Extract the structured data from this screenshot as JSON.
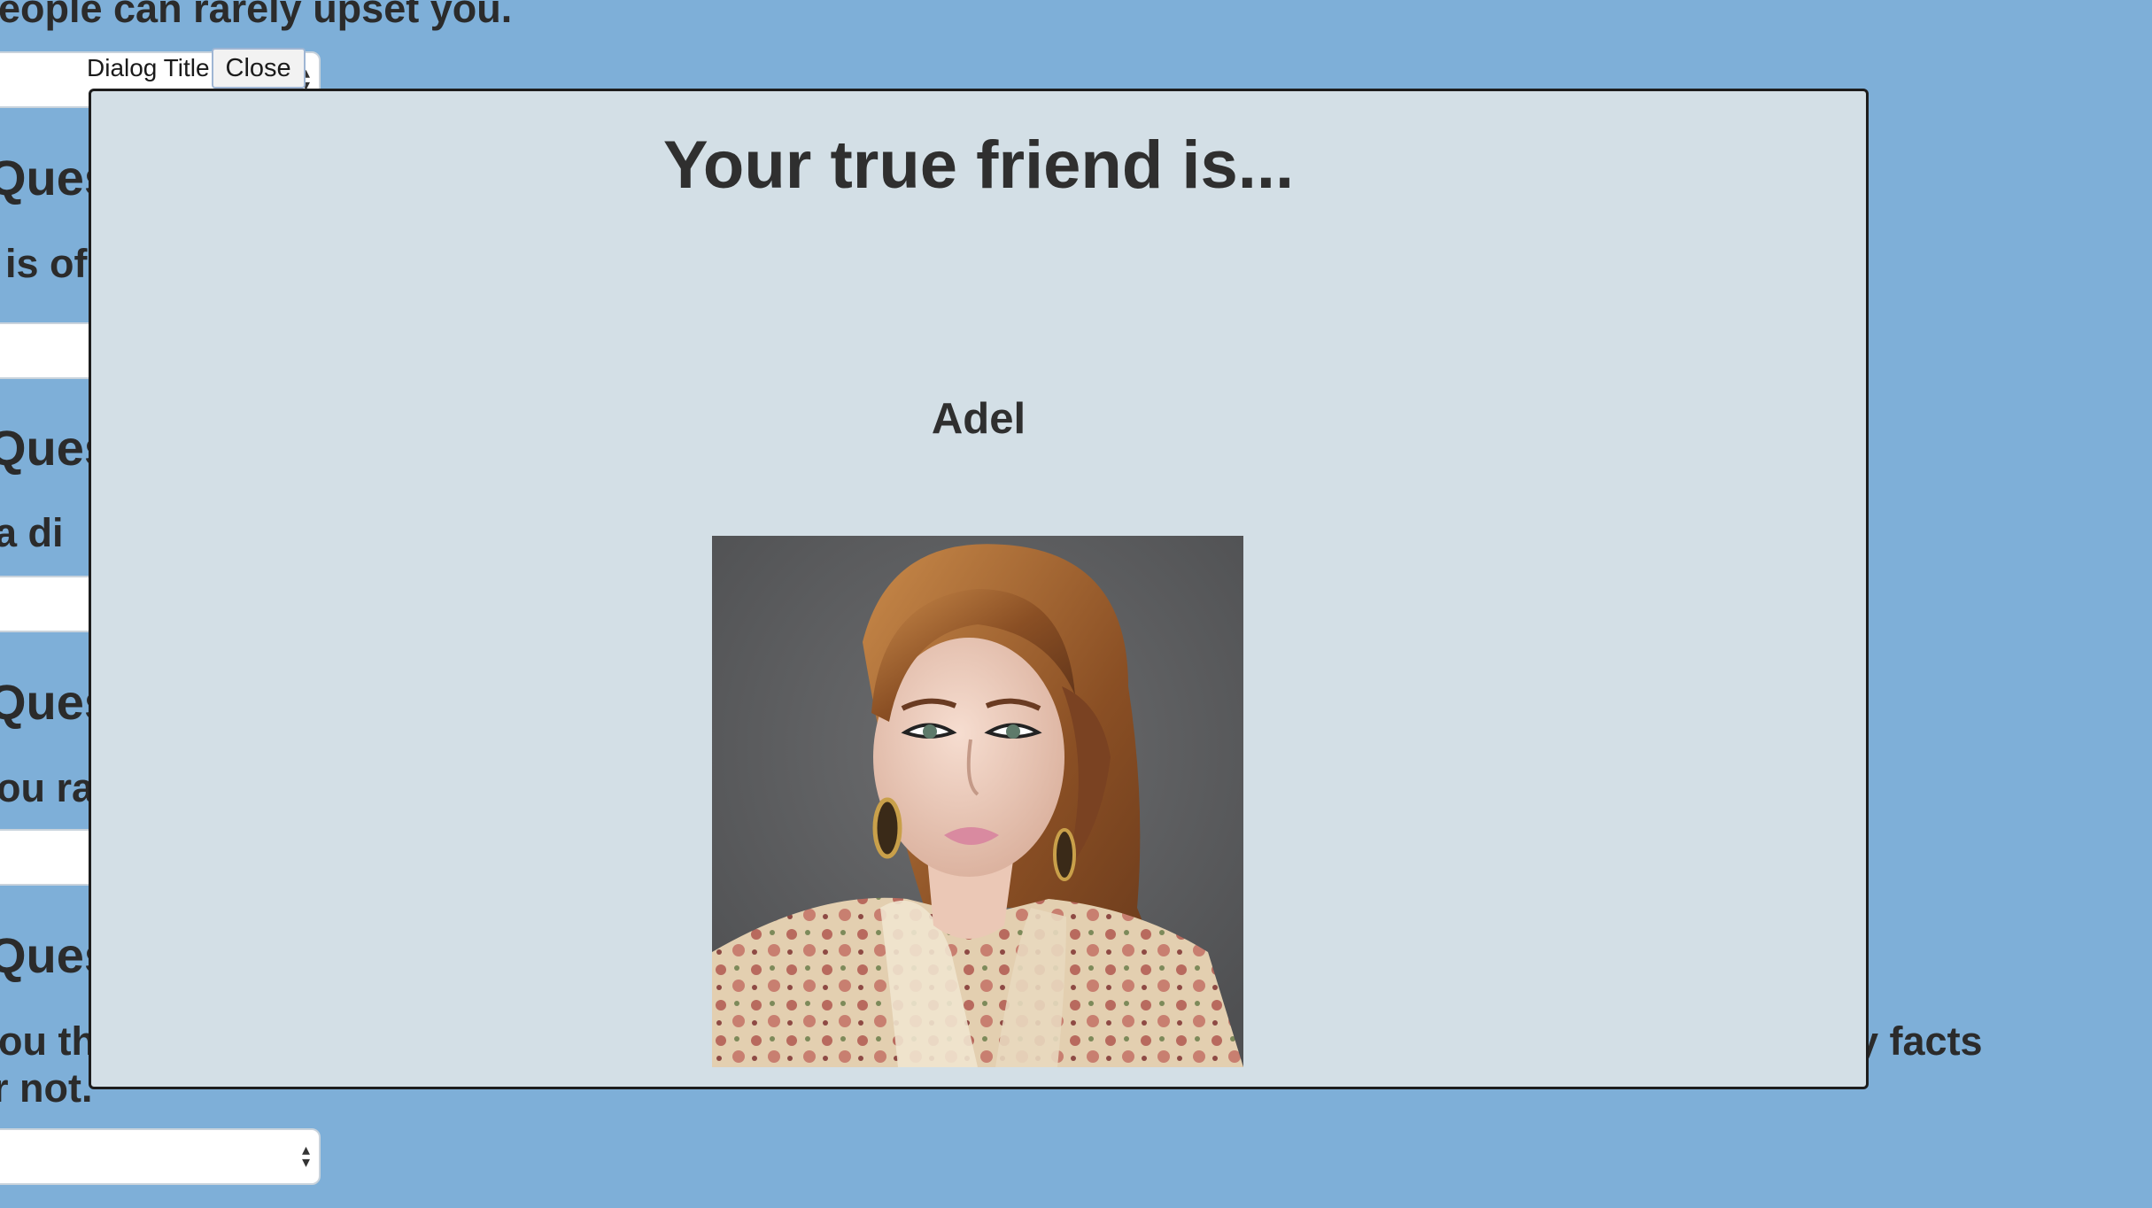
{
  "background": {
    "top_line": "eople can rarely upset you.",
    "questions": [
      {
        "heading": "Ques",
        "text": "is of"
      },
      {
        "heading": "Ques",
        "text": "a di"
      },
      {
        "heading": "Ques",
        "text": "ou ra"
      },
      {
        "heading": "Ques",
        "text": "ou th",
        "right_fragment": "y facts",
        "second_line": "r not."
      }
    ]
  },
  "dialog": {
    "title": "Dialog Title",
    "close_label": "Close",
    "heading": "Your true friend is...",
    "result_name": "Adel"
  },
  "colors": {
    "page_background": "#7eafd8",
    "dialog_background": "#d3dfe6"
  }
}
